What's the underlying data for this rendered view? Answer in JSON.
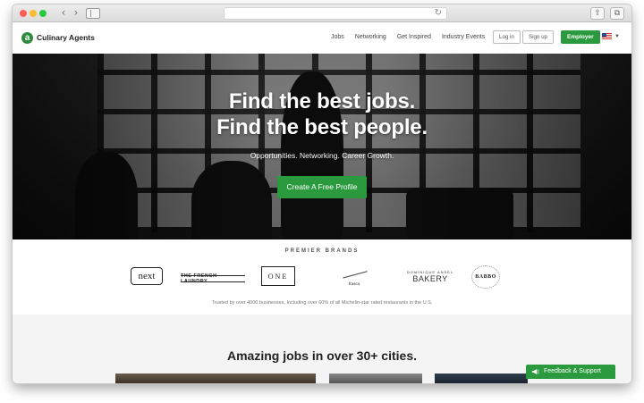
{
  "browser": {
    "back_glyph": "‹",
    "forward_glyph": "›",
    "reload_glyph": "↻",
    "share_glyph": "⇧",
    "tabs_glyph": "⧉"
  },
  "header": {
    "logo_letter": "a",
    "brand_name": "Culinary Agents",
    "nav": [
      "Jobs",
      "Networking",
      "Get Inspired",
      "Industry Events"
    ],
    "login_label": "Log in",
    "signup_label": "Sign up",
    "employer_label": "Employer",
    "caret": "▼"
  },
  "hero": {
    "headline_1": "Find the best jobs.",
    "headline_2": "Find the best people.",
    "subheadline": "Opportunities. Networking. Career Growth.",
    "cta_label": "Create A Free Profile"
  },
  "brands": {
    "heading": "PREMIER BRANDS",
    "logos": {
      "next": "next",
      "french_laundry": "THE FRENCH LAUNDRY",
      "one": "ONE",
      "frasca": "frasca",
      "dominique_top": "DOMINIQUE ANSEL",
      "dominique_bottom": "BAKERY",
      "babbo": "BABBO"
    },
    "trust_text": "Trusted by over 4000 businesses, Including over 60% of all Michelin-star rated restaurants in the U.S."
  },
  "jobs": {
    "heading": "Amazing jobs in over 30+ cities."
  },
  "feedback": {
    "label": "Feedback & Support"
  },
  "colors": {
    "brand_green": "#2b9a3e",
    "hero_text": "#ffffff"
  }
}
